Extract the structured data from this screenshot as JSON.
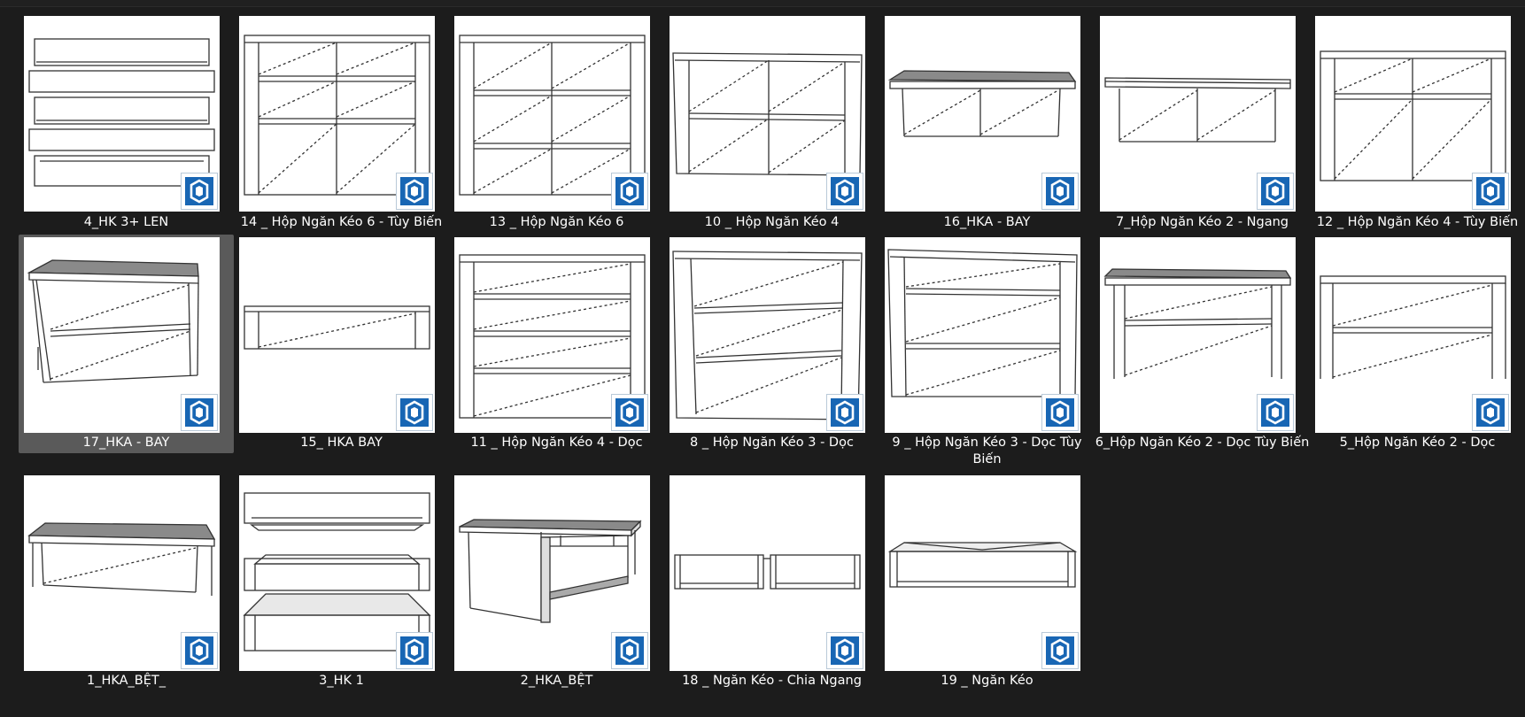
{
  "icon": "sketchup-file-icon",
  "accent_color": "#1866b4",
  "selected_item": "17_HKA - BAY",
  "files": [
    {
      "name": "4_HK 3+ LEN",
      "drawing": "stacked-drawers-icon"
    },
    {
      "name": "14 _ Hộp Ngăn Kéo 6 - Tùy Biến",
      "drawing": "cabinet-six-drawers-icon"
    },
    {
      "name": "13 _ Hộp Ngăn Kéo 6",
      "drawing": "cabinet-six-drawers-icon"
    },
    {
      "name": "10 _ Hộp Ngăn Kéo 4",
      "drawing": "cabinet-four-drawers-icon"
    },
    {
      "name": "16_HKA - BAY",
      "drawing": "low-cabinet-two-drawers-icon"
    },
    {
      "name": "7_Hộp Ngăn Kéo 2 - Ngang",
      "drawing": "low-cabinet-two-drawers-icon"
    },
    {
      "name": "12 _ Hộp Ngăn Kéo 4 - Tùy Biến",
      "drawing": "cabinet-four-drawers-icon"
    },
    {
      "name": "17_HKA - BAY",
      "drawing": "cabinet-two-vertical-drawers-icon"
    },
    {
      "name": "15_ HKA BAY",
      "drawing": "single-drawer-icon"
    },
    {
      "name": "11 _ Hộp Ngăn Kéo 4 - Dọc",
      "drawing": "cabinet-four-vertical-drawers-icon"
    },
    {
      "name": "8 _ Hộp Ngăn Kéo 3 - Dọc",
      "drawing": "cabinet-three-vertical-drawers-icon"
    },
    {
      "name": "9 _ Hộp Ngăn Kéo 3 - Dọc Tùy Biến",
      "drawing": "cabinet-three-vertical-drawers-icon"
    },
    {
      "name": "6_Hộp Ngăn Kéo 2 - Dọc Tùy Biến",
      "drawing": "cabinet-two-vertical-drawers-icon"
    },
    {
      "name": "5_Hộp Ngăn Kéo 2 - Dọc",
      "drawing": "cabinet-two-vertical-drawers-icon"
    },
    {
      "name": "1_HKA_BỆT_",
      "drawing": "low-cabinet-one-drawer-icon"
    },
    {
      "name": "3_HK 1",
      "drawing": "stacked-drawers-icon"
    },
    {
      "name": "2_HKA_BỆT",
      "drawing": "table-frame-icon"
    },
    {
      "name": "18 _ Ngăn Kéo - Chia Ngang",
      "drawing": "split-drawer-icon"
    },
    {
      "name": "19 _ Ngăn Kéo",
      "drawing": "open-drawer-icon"
    }
  ]
}
